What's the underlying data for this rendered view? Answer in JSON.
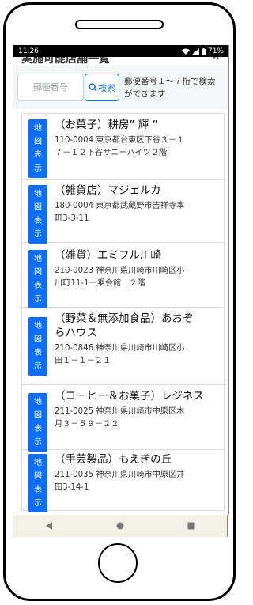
{
  "status": {
    "time": "11:26",
    "battery": "71%"
  },
  "page": {
    "title": "実施可能店舗一覧"
  },
  "search": {
    "placeholder": "郵便番号",
    "button_label": "検索",
    "help_line1": "郵便番号１〜７桁で検索",
    "help_line2": "ができます"
  },
  "map_button": {
    "chars": [
      "地",
      "図",
      "表",
      "示"
    ]
  },
  "shops": [
    {
      "name_lines": [
        "（お菓子）耕房” 輝 ”"
      ],
      "addr_lines": [
        "110-0004 東京都台東区下谷３－１",
        "７－１２下谷サニーハイツ２階"
      ]
    },
    {
      "name_lines": [
        "（雑貨店）マジェルカ"
      ],
      "addr_lines": [
        "180-0004 東京都武蔵野市吉祥寺本",
        "町3-3-11"
      ]
    },
    {
      "name_lines": [
        "（雑貨）エミフル川崎"
      ],
      "addr_lines": [
        "210-0023 神奈川県川崎市川崎区小",
        "川町11-1一乗会館　２階"
      ]
    },
    {
      "name_lines": [
        "（野菜＆無添加食品）あおぞ",
        "らハウス"
      ],
      "addr_lines": [
        "210-0846 神奈川県川崎市川崎区小",
        "田１－１－２１"
      ]
    },
    {
      "name_lines": [
        "（コーヒー＆お菓子）レジネス"
      ],
      "addr_lines": [
        "211-0025 神奈川県川崎市中原区木",
        "月３－５９－２２"
      ]
    },
    {
      "name_lines": [
        "（手芸製品）もえぎの丘"
      ],
      "addr_lines": [
        "211-0035 神奈川県川崎市中原区井",
        "田3-14-1"
      ]
    }
  ],
  "colors": {
    "primary": "#0d6efd",
    "nav_bg": "#f3f1e6"
  }
}
